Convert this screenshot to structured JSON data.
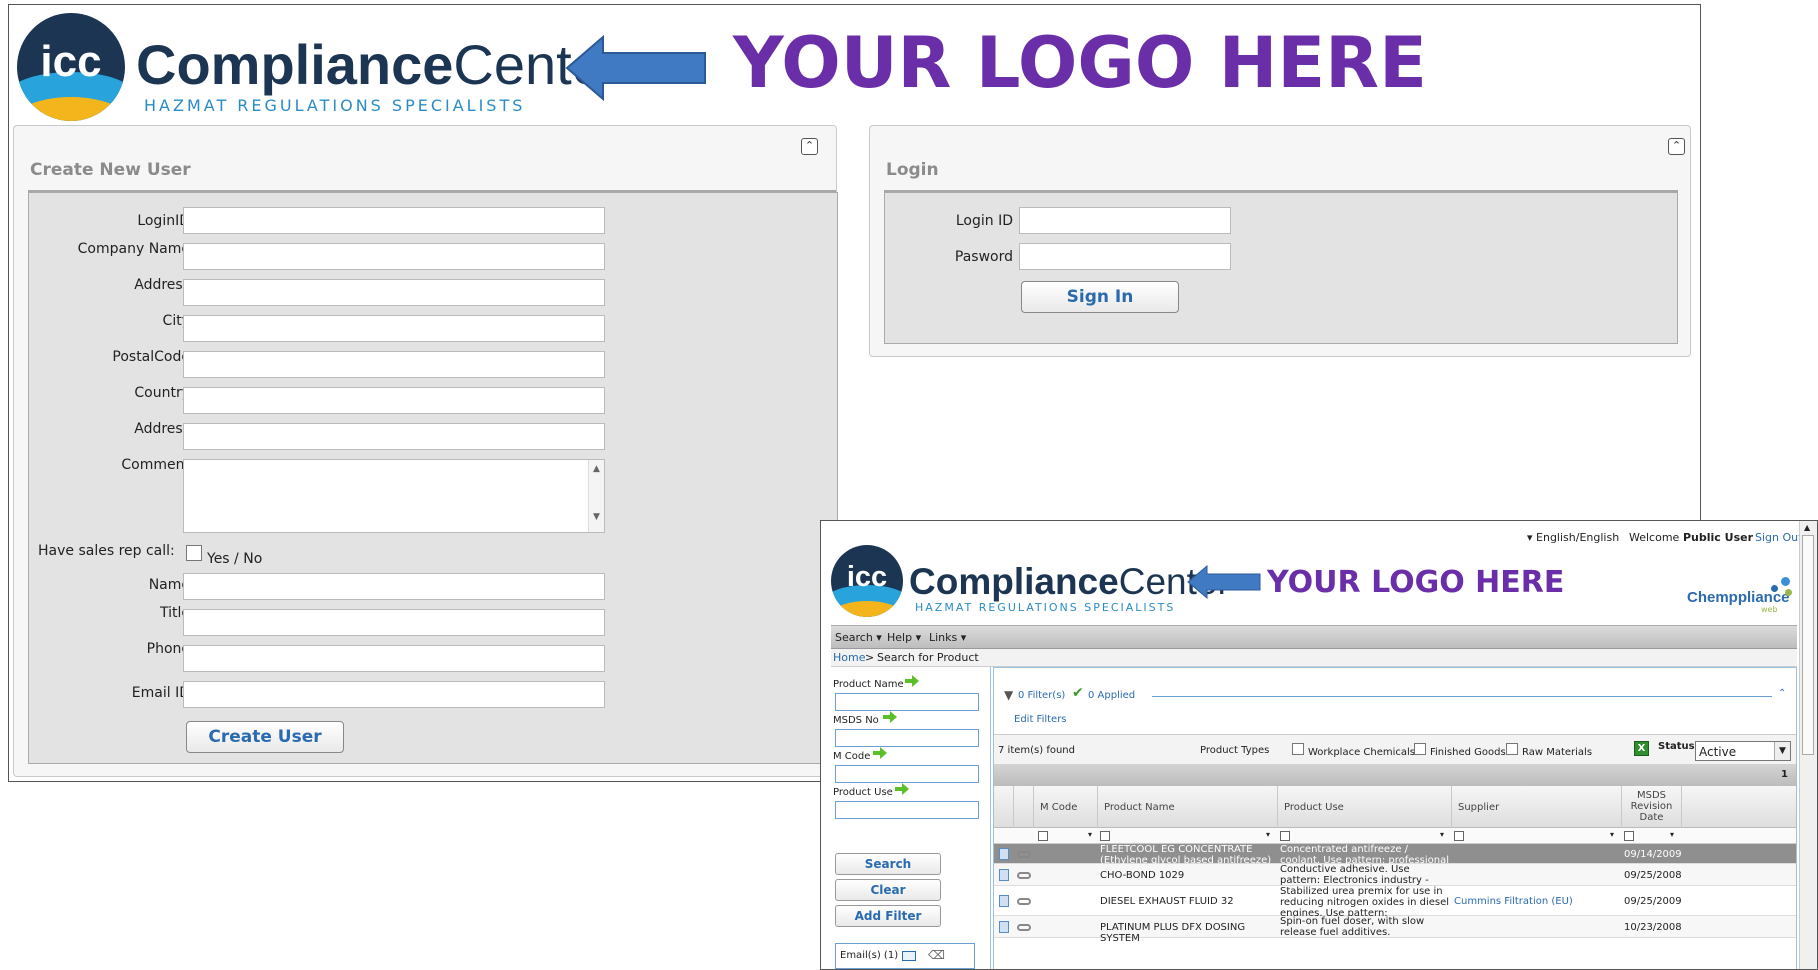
{
  "brand": {
    "badge_text": "icc",
    "name_bold": "Compliance",
    "name_regular": "Center",
    "tagline": "HAZMAT  REGULATIONS SPECIALISTS",
    "logo_placeholder": "YOUR LOGO HERE",
    "colors": {
      "navy": "#1b3553",
      "sky": "#28a3dc",
      "gold": "#f4b51c",
      "arrow": "#3f7ac2",
      "logo_purple": "#6a2ea8"
    }
  },
  "create_user": {
    "title": "Create New User",
    "collapse_icon": "double-chevron-up-icon",
    "fields": {
      "login_id": {
        "label": "LoginID",
        "value": ""
      },
      "company_name": {
        "label": "Company Name",
        "value": ""
      },
      "address": {
        "label": "Address",
        "value": ""
      },
      "city": {
        "label": "City",
        "value": ""
      },
      "postal_code": {
        "label": "PostalCode",
        "value": ""
      },
      "country": {
        "label": "Country",
        "value": ""
      },
      "address2": {
        "label": "Address",
        "value": ""
      },
      "comment": {
        "label": "Comment",
        "value": ""
      },
      "sales_rep": {
        "label": "Have sales rep call:",
        "option": "Yes / No",
        "checked": false
      },
      "name": {
        "label": "Name",
        "value": ""
      },
      "title": {
        "label": "Title",
        "value": ""
      },
      "phone": {
        "label": "Phone",
        "value": ""
      },
      "email": {
        "label": "Email ID",
        "value": ""
      }
    },
    "submit_label": "Create User"
  },
  "login": {
    "title": "Login",
    "login_id_label": "Login ID",
    "password_label": "Pasword",
    "login_id_value": "",
    "password_value": "",
    "submit_label": "Sign In"
  },
  "inset": {
    "top_bar": {
      "language": "English/English",
      "welcome": "Welcome",
      "user": "Public User",
      "sign_out": "Sign Out"
    },
    "partner_logo": "Chemppliance",
    "partner_logo_sub": "web",
    "menu": [
      "Search",
      "Help",
      "Links"
    ],
    "breadcrumb": {
      "home": "Home",
      "separator": ">",
      "current": "Search for Product"
    },
    "search_panel": {
      "product_name_label": "Product Name",
      "msds_no_label": "MSDS No",
      "m_code_label": "M Code",
      "product_use_label": "Product Use",
      "search_button": "Search",
      "clear_button": "Clear",
      "add_filter_button": "Add Filter",
      "email_label": "Email(s) (1)"
    },
    "filters": {
      "filters_count": "0 Filter(s)",
      "applied_count": "0 Applied",
      "edit_filters": "Edit Filters"
    },
    "results": {
      "items_found": "7 item(s) found",
      "product_types_label": "Product Types",
      "types": [
        "Workplace Chemicals",
        "Finished Goods",
        "Raw Materials"
      ],
      "status_label": "Status",
      "status_value": "Active",
      "page_number": "1",
      "columns": [
        "M Code",
        "Product Name",
        "Product Use",
        "Supplier",
        "MSDS Revision Date"
      ],
      "rows": [
        {
          "m_code": "",
          "product_name": "FLEETCOOL EG CONCENTRATE (Ethylene glycol based antifreeze)",
          "product_use": "Concentrated antifreeze / coolant. Use pattern: professional use; Consumers.",
          "supplier": "",
          "date": "09/14/2009",
          "selected": true
        },
        {
          "m_code": "",
          "product_name": "CHO-BOND 1029",
          "product_use": "Conductive adhesive. Use pattern: Electronics industry - professional use.",
          "supplier": "",
          "date": "09/25/2008",
          "selected": false
        },
        {
          "m_code": "",
          "product_name": "DIESEL EXHAUST FLUID 32",
          "product_use": "Stabilized urea premix for use in reducing nitrogen oxides in diesel engines. Use pattern: professional use; Consumers. .",
          "supplier": "Cummins Filtration (EU)",
          "date": "09/25/2009",
          "selected": false
        },
        {
          "m_code": "",
          "product_name": "PLATINUM PLUS DFX DOSING SYSTEM",
          "product_use": "Spin-on fuel doser, with slow release fuel additives.",
          "supplier": "",
          "date": "10/23/2008",
          "selected": false
        }
      ]
    }
  }
}
